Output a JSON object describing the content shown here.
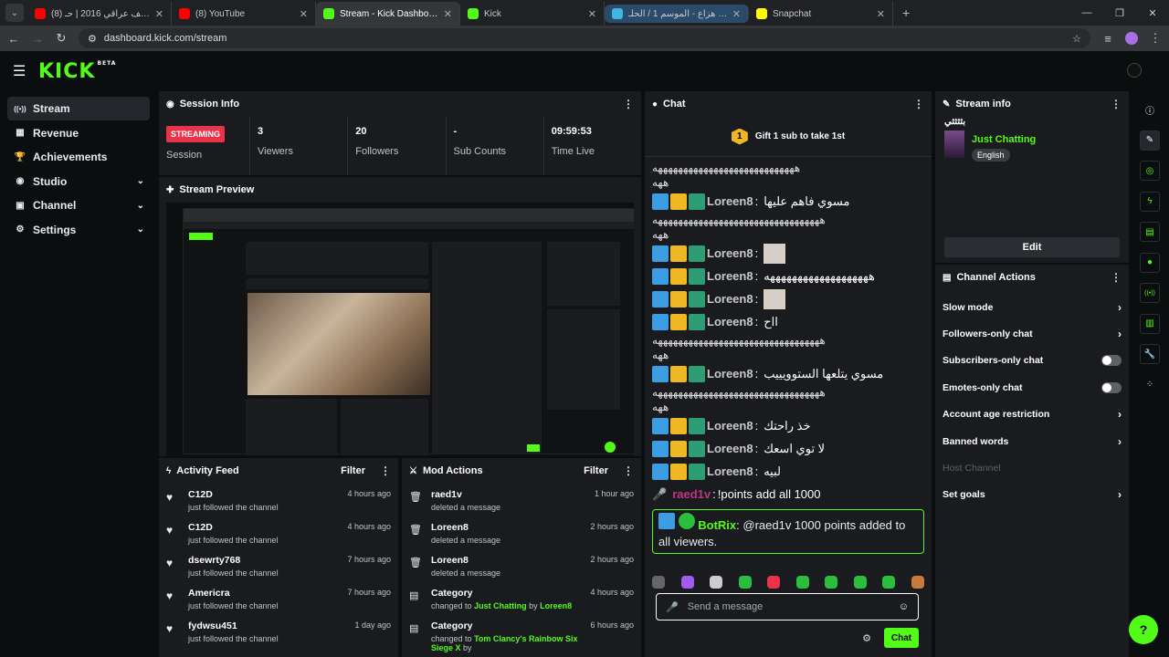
{
  "browser": {
    "tabs": [
      {
        "title": "(8) اغاني ارشيف عراقي 2016 | حـ...",
        "fav_color": "#ff0000",
        "active": false
      },
      {
        "title": "(8) YouTube",
        "fav_color": "#ff0000",
        "active": false
      },
      {
        "title": "Stream - Kick Dashboard",
        "fav_color": "#53fc18",
        "active": true
      },
      {
        "title": "Kick",
        "fav_color": "#53fc18",
        "active": false
      },
      {
        "title": "شاهد هزاع - الموسم 1 / الحلـ...",
        "fav_color": "#3fb7e0",
        "active": false
      },
      {
        "title": "Snapchat",
        "fav_color": "#fffc00",
        "active": false
      }
    ],
    "url": "dashboard.kick.com/stream"
  },
  "brand": {
    "logo": "KICK",
    "beta": "BETA",
    "accent": "#53fc18"
  },
  "sidebar": {
    "items": [
      {
        "label": "Stream",
        "icon": "broadcast-icon"
      },
      {
        "label": "Revenue",
        "icon": "revenue-icon"
      },
      {
        "label": "Achievements",
        "icon": "trophy-icon"
      },
      {
        "label": "Studio",
        "icon": "studio-icon"
      },
      {
        "label": "Channel",
        "icon": "channel-icon"
      },
      {
        "label": "Settings",
        "icon": "gear-icon"
      }
    ]
  },
  "session": {
    "title": "Session Info",
    "status": "STREAMING",
    "status_label": "Session",
    "stats": [
      {
        "value": "3",
        "label": "Viewers"
      },
      {
        "value": "20",
        "label": "Followers"
      },
      {
        "value": "-",
        "label": "Sub Counts"
      },
      {
        "value": "09:59:53",
        "label": "Time Live"
      }
    ]
  },
  "preview": {
    "title": "Stream Preview"
  },
  "activity": {
    "title": "Activity Feed",
    "filter": "Filter",
    "items": [
      {
        "name": "C12D",
        "sub": "just followed the channel",
        "time": "4 hours ago"
      },
      {
        "name": "C12D",
        "sub": "just followed the channel",
        "time": "4 hours ago"
      },
      {
        "name": "dsewrty768",
        "sub": "just followed the channel",
        "time": "7 hours ago"
      },
      {
        "name": "Americra",
        "sub": "just followed the channel",
        "time": "7 hours ago"
      },
      {
        "name": "fydwsu451",
        "sub": "just followed the channel",
        "time": "1 day ago"
      }
    ]
  },
  "mod": {
    "title": "Mod Actions",
    "filter": "Filter",
    "items": [
      {
        "name": "raed1v",
        "sub": "deleted a message",
        "time": "1 hour ago",
        "icon": "trash-icon"
      },
      {
        "name": "Loreen8",
        "sub": "deleted a message",
        "time": "2 hours ago",
        "icon": "trash-icon"
      },
      {
        "name": "Loreen8",
        "sub": "deleted a message",
        "time": "2 hours ago",
        "icon": "trash-icon"
      },
      {
        "name": "Category",
        "sub_pre": "changed to",
        "sub_hl": "Just Chatting",
        "sub_mid": "by",
        "sub_user": "Loreen8",
        "time": "4 hours ago",
        "icon": "category-icon"
      },
      {
        "name": "Category",
        "sub_pre": "changed to",
        "sub_hl": "Tom Clancy's Rainbow Six Siege X",
        "sub_mid": "by",
        "sub_user": "",
        "time": "6 hours ago",
        "icon": "category-icon"
      }
    ]
  },
  "chat": {
    "title": "Chat",
    "gift_rank": "1",
    "gift": "Gift 1 sub to take 1st",
    "messages": [
      {
        "type": "wrap",
        "text": "ههههههههههههههههههههههههههههه"
      },
      {
        "type": "wrap",
        "text": "ههه"
      },
      {
        "type": "msg",
        "user": "Loreen8",
        "text": "مسوي فاهم عليها"
      },
      {
        "type": "wrap",
        "text": "هههههههههههههههههههههههههههههههههه"
      },
      {
        "type": "wrap",
        "text": "ههه"
      },
      {
        "type": "img",
        "user": "Loreen8"
      },
      {
        "type": "msg",
        "user": "Loreen8",
        "text": "هههههههههههههههههههه"
      },
      {
        "type": "img",
        "user": "Loreen8"
      },
      {
        "type": "msg",
        "user": "Loreen8",
        "text": "ااح"
      },
      {
        "type": "wrap",
        "text": "هههههههههههههههههههههههههههههههههه"
      },
      {
        "type": "wrap",
        "text": "ههه"
      },
      {
        "type": "msg",
        "user": "Loreen8",
        "text": "مسوي يتلعها الستوويييب"
      },
      {
        "type": "wrap",
        "text": "هههههههههههههههههههههههههههههههههه"
      },
      {
        "type": "wrap",
        "text": "ههه"
      },
      {
        "type": "msg",
        "user": "Loreen8",
        "text": "خذ راحتك"
      },
      {
        "type": "msg",
        "user": "Loreen8",
        "text": "لا توي اسعك"
      },
      {
        "type": "msg",
        "user": "Loreen8",
        "text": "لبيه"
      },
      {
        "type": "cmd",
        "user": "raed1v",
        "text": "!points add all 1000"
      }
    ],
    "bot": {
      "user": "BotRix",
      "text": "@raed1v 1000 points added to all viewers."
    },
    "placeholder": "Send a message",
    "send": "Chat"
  },
  "stream_info": {
    "title": "Stream info",
    "stream_title": "بثثثثي",
    "category": "Just Chatting",
    "language": "English",
    "edit": "Edit"
  },
  "channel_actions": {
    "title": "Channel Actions",
    "items": [
      {
        "label": "Slow mode",
        "kind": "chev"
      },
      {
        "label": "Followers-only chat",
        "kind": "chev"
      },
      {
        "label": "Subscribers-only chat",
        "kind": "toggle"
      },
      {
        "label": "Emotes-only chat",
        "kind": "toggle"
      },
      {
        "label": "Account age restriction",
        "kind": "chev"
      },
      {
        "label": "Banned words",
        "kind": "chev"
      },
      {
        "label": "Host Channel",
        "kind": "dim"
      },
      {
        "label": "Set goals",
        "kind": "chev"
      }
    ]
  },
  "rail": [
    "info-icon",
    "pencil-icon",
    "camera-icon",
    "lightning-icon",
    "doc-icon",
    "chat-icon",
    "broadcast-icon",
    "layout-icon",
    "wrench-icon",
    "dots-icon"
  ]
}
